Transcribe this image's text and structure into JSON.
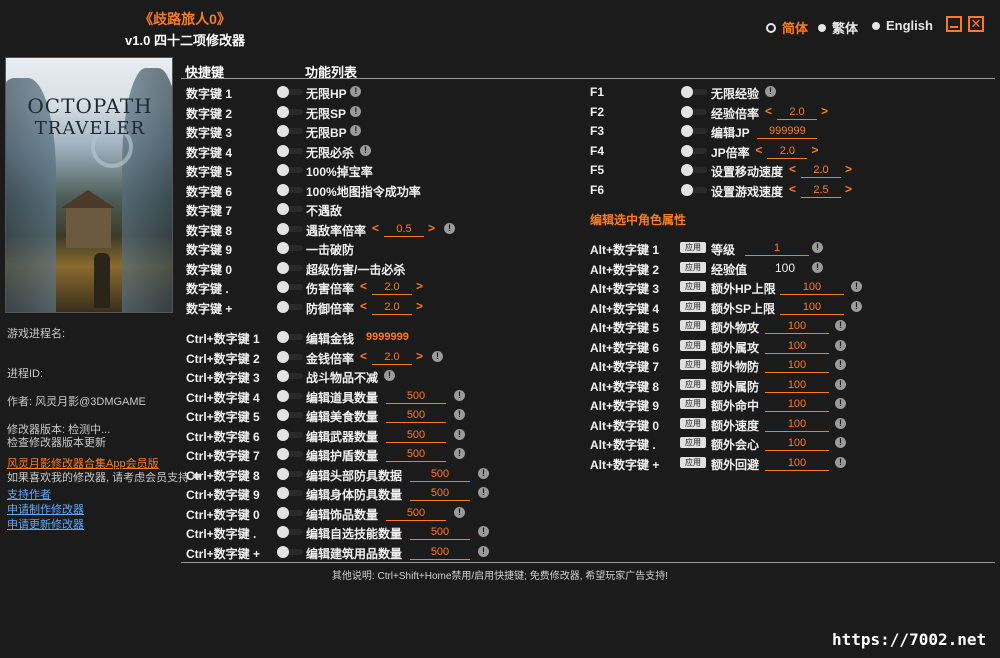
{
  "header": {
    "game_title": "《歧路旅人0》",
    "version_title": "v1.0 四十二项修改器",
    "languages": [
      {
        "label": "简体",
        "active": true
      },
      {
        "label": "繁体",
        "active": false
      },
      {
        "label": "English",
        "active": false
      }
    ],
    "close_glyph": "✕"
  },
  "cover": {
    "logo_line1": "OCTOPATH",
    "logo_line2": "TRAVELER"
  },
  "sidebar": {
    "process_label": "游戏进程名:",
    "pid_label": "进程ID:",
    "author": "作者: 风灵月影@3DMGAME",
    "version_line": "修改器版本: 检测中...",
    "check_update": "检查修改器版本更新",
    "promo": "风灵月影修改器合集App会员版",
    "support_line": "如果喜欢我的修改器, 请考虑会员支持 ❤",
    "links": [
      "支持作者",
      "申请制作修改器",
      "申请更新修改器"
    ]
  },
  "columns": {
    "hotkeys": "快捷键",
    "features": "功能列表"
  },
  "left_list": [
    {
      "key": "数字键 1",
      "label": "无限HP",
      "info": true
    },
    {
      "key": "数字键 2",
      "label": "无限SP",
      "info": true
    },
    {
      "key": "数字键 3",
      "label": "无限BP",
      "info": true
    },
    {
      "key": "数字键 4",
      "label": "无限必杀",
      "info": true
    },
    {
      "key": "数字键 5",
      "label": "100%掉宝率"
    },
    {
      "key": "数字键 6",
      "label": "100%地图指令成功率"
    },
    {
      "key": "数字键 7",
      "label": "不遇敌"
    },
    {
      "key": "数字键 8",
      "label": "遇敌率倍率",
      "stepper": "0.5",
      "info": true
    },
    {
      "key": "数字键 9",
      "label": "一击破防"
    },
    {
      "key": "数字键 0",
      "label": "超级伤害/一击必杀"
    },
    {
      "key": "数字键 .",
      "label": "伤害倍率",
      "stepper": "2.0"
    },
    {
      "key": "数字键 +",
      "label": "防御倍率",
      "stepper": "2.0"
    },
    {
      "key": "Ctrl+数字键 1",
      "label": "编辑金钱",
      "value": "9999999"
    },
    {
      "key": "Ctrl+数字键 2",
      "label": "金钱倍率",
      "stepper": "2.0",
      "info": true
    },
    {
      "key": "Ctrl+数字键 3",
      "label": "战斗物品不减",
      "info": true
    },
    {
      "key": "Ctrl+数字键 4",
      "label": "编辑道具数量",
      "field": "500",
      "info": true
    },
    {
      "key": "Ctrl+数字键 5",
      "label": "编辑美食数量",
      "field": "500",
      "info": true
    },
    {
      "key": "Ctrl+数字键 6",
      "label": "编辑武器数量",
      "field": "500",
      "info": true
    },
    {
      "key": "Ctrl+数字键 7",
      "label": "编辑护盾数量",
      "field": "500",
      "info": true
    },
    {
      "key": "Ctrl+数字键 8",
      "label": "编辑头部防具数据",
      "field": "500",
      "info": true
    },
    {
      "key": "Ctrl+数字键 9",
      "label": "编辑身体防具数量",
      "field": "500",
      "info": true
    },
    {
      "key": "Ctrl+数字键 0",
      "label": "编辑饰品数量",
      "field": "500",
      "info": true
    },
    {
      "key": "Ctrl+数字键 .",
      "label": "编辑自选技能数量",
      "field": "500",
      "info": true
    },
    {
      "key": "Ctrl+数字键 +",
      "label": "编辑建筑用品数量",
      "field": "500",
      "info": true
    }
  ],
  "right_top": [
    {
      "key": "F1",
      "label": "无限经验",
      "info": true
    },
    {
      "key": "F2",
      "label": "经验倍率",
      "stepper": "2.0"
    },
    {
      "key": "F3",
      "label": "编辑JP",
      "field": "999999"
    },
    {
      "key": "F4",
      "label": "JP倍率",
      "stepper": "2.0"
    },
    {
      "key": "F5",
      "label": "设置移动速度",
      "stepper": "2.0"
    },
    {
      "key": "F6",
      "label": "设置游戏速度",
      "stepper": "2.5"
    }
  ],
  "section_title": "编辑选中角色属性",
  "apply_label": "应用",
  "right_attrs": [
    {
      "key": "Alt+数字键 1",
      "label": "等级",
      "value": "1"
    },
    {
      "key": "Alt+数字键 2",
      "label": "经验值",
      "value": "100"
    },
    {
      "key": "Alt+数字键 3",
      "label": "额外HP上限",
      "value": "100"
    },
    {
      "key": "Alt+数字键 4",
      "label": "额外SP上限",
      "value": "100"
    },
    {
      "key": "Alt+数字键 5",
      "label": "额外物攻",
      "value": "100"
    },
    {
      "key": "Alt+数字键 6",
      "label": "额外属攻",
      "value": "100"
    },
    {
      "key": "Alt+数字键 7",
      "label": "额外物防",
      "value": "100"
    },
    {
      "key": "Alt+数字键 8",
      "label": "额外属防",
      "value": "100"
    },
    {
      "key": "Alt+数字键 9",
      "label": "额外命中",
      "value": "100"
    },
    {
      "key": "Alt+数字键 0",
      "label": "额外速度",
      "value": "100"
    },
    {
      "key": "Alt+数字键 .",
      "label": "额外会心",
      "value": "100"
    },
    {
      "key": "Alt+数字键 +",
      "label": "额外回避",
      "value": "100"
    }
  ],
  "footer": "其他说明: Ctrl+Shift+Home禁用/启用快捷键; 免费修改器, 希望玩家广告支持!",
  "watermark": "https://7002.net",
  "colors": {
    "accent": "#ff7a1a",
    "background": "#1b1b1b",
    "link": "#5fa8ff"
  }
}
